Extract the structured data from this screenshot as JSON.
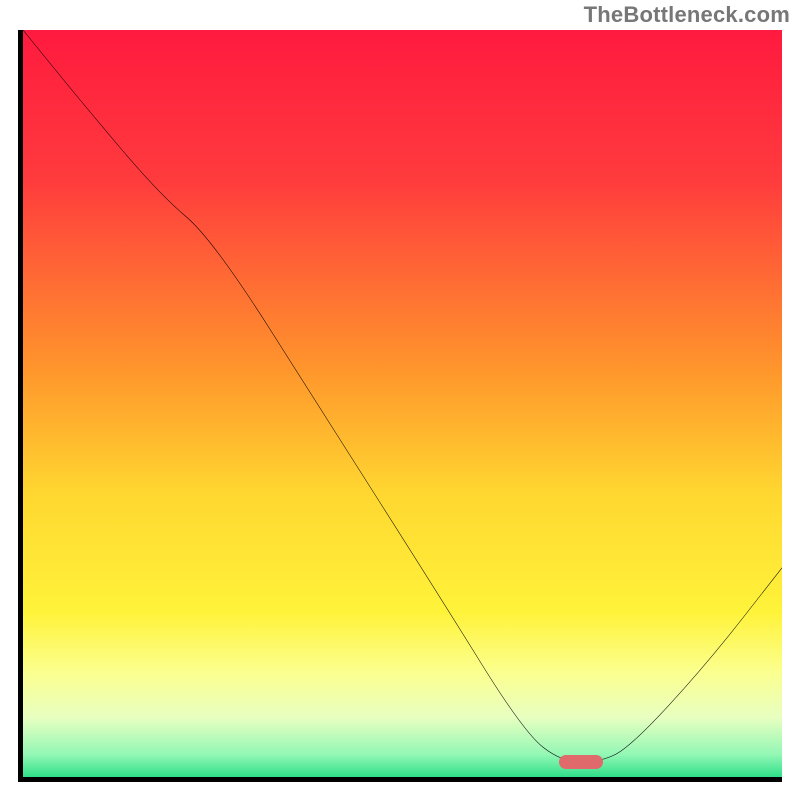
{
  "watermark": "TheBottleneck.com",
  "chart_data": {
    "type": "line",
    "title": "",
    "xlabel": "",
    "ylabel": "",
    "xlim": [
      0,
      100
    ],
    "ylim": [
      0,
      100
    ],
    "grid": false,
    "legend": false,
    "gradient_stops": [
      {
        "offset": 0,
        "color": "#ff1a3f"
      },
      {
        "offset": 20,
        "color": "#ff3b3d"
      },
      {
        "offset": 45,
        "color": "#ff942c"
      },
      {
        "offset": 62,
        "color": "#ffd730"
      },
      {
        "offset": 78,
        "color": "#fff33a"
      },
      {
        "offset": 86,
        "color": "#fbff8f"
      },
      {
        "offset": 92,
        "color": "#e8ffc0"
      },
      {
        "offset": 97,
        "color": "#93f7b5"
      },
      {
        "offset": 100,
        "color": "#2fe089"
      }
    ],
    "series": [
      {
        "name": "bottleneck-curve",
        "x": [
          0,
          8,
          18,
          25,
          40,
          55,
          66,
          71,
          76,
          80,
          90,
          100
        ],
        "values": [
          100,
          90,
          78,
          72,
          48,
          24,
          6,
          2,
          2,
          4,
          15,
          28
        ]
      }
    ],
    "optimal_marker": {
      "x": 73.5,
      "y": 2,
      "color": "#e06a6b"
    }
  }
}
